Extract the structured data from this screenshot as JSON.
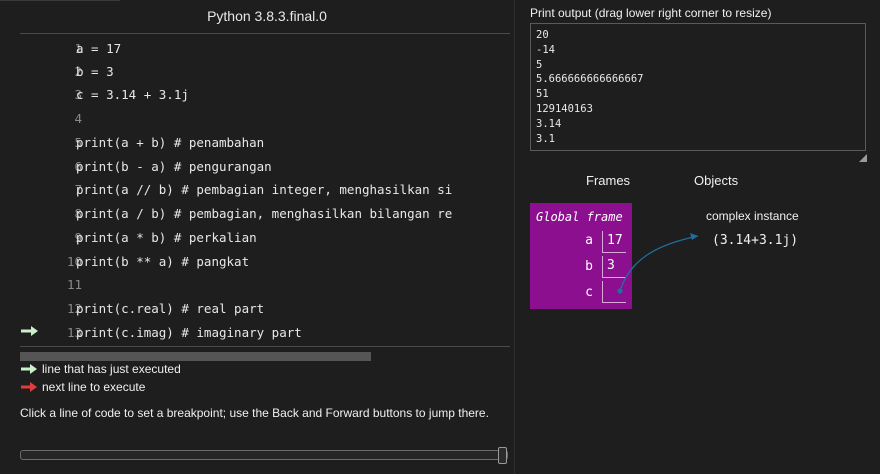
{
  "header": {
    "language": "Python 3.8.3.final.0"
  },
  "code": {
    "lines": [
      {
        "num": "1",
        "text": "a = 17"
      },
      {
        "num": "2",
        "text": "b = 3"
      },
      {
        "num": "3",
        "text": "c = 3.14 + 3.1j"
      },
      {
        "num": "4",
        "text": ""
      },
      {
        "num": "5",
        "text": "print(a + b) # penambahan"
      },
      {
        "num": "6",
        "text": "print(b - a) # pengurangan"
      },
      {
        "num": "7",
        "text": "print(a // b) # pembagian integer, menghasilkan si"
      },
      {
        "num": "8",
        "text": "print(a / b) # pembagian, menghasilkan bilangan re"
      },
      {
        "num": "9",
        "text": "print(a * b) # perkalian"
      },
      {
        "num": "10",
        "text": "print(b ** a) # pangkat"
      },
      {
        "num": "11",
        "text": ""
      },
      {
        "num": "12",
        "text": "print(c.real) # real part"
      },
      {
        "num": "13",
        "text": "print(c.imag) # imaginary part"
      }
    ],
    "current_line": "13"
  },
  "legend": {
    "executed": "line that has just executed",
    "next": "next line to execute"
  },
  "hint": "Click a line of code to set a breakpoint; use the Back and Forward buttons to jump there.",
  "progress": {
    "fraction": 1.0
  },
  "output": {
    "label": "Print output (drag lower right corner to resize)",
    "text": "20\n-14\n5\n5.666666666666667\n51\n129140163\n3.14\n3.1"
  },
  "viz": {
    "frames_header": "Frames",
    "objects_header": "Objects",
    "global_frame": {
      "title": "Global frame",
      "vars": [
        {
          "name": "a",
          "value": "17"
        },
        {
          "name": "b",
          "value": "3"
        },
        {
          "name": "c",
          "value": ""
        }
      ]
    },
    "object": {
      "type_label": "complex instance",
      "value": "(3.14+3.1j)"
    }
  },
  "colors": {
    "frame_bg": "#8b0f8f",
    "executed_arrow": "#c9f0c9",
    "next_arrow": "#e23b3b",
    "pointer": "#1f6f9f"
  }
}
